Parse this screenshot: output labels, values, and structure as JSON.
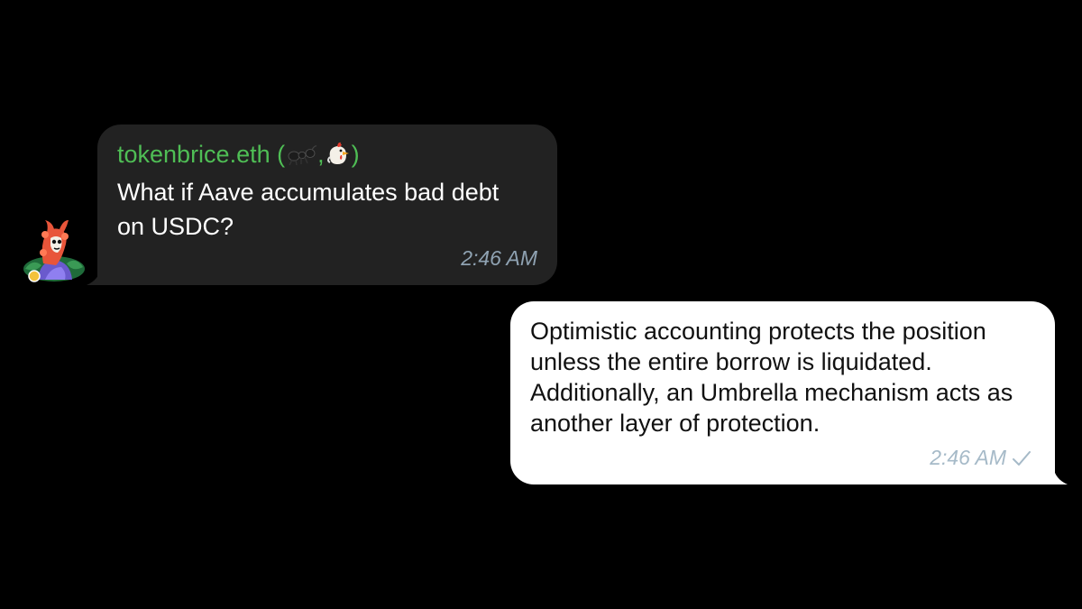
{
  "messages": {
    "incoming": {
      "sender": "tokenbrice.eth (",
      "sender_suffix": ")",
      "sender_emojis": [
        "ant-emoji",
        "chicken-emoji"
      ],
      "sender_separator": ",",
      "text": "What if Aave accumulates bad debt on USDC?",
      "time": "2:46 AM",
      "avatar": "llama-avatar"
    },
    "outgoing": {
      "text": "Optimistic accounting protects the position unless the entire borrow is liquidated. Additionally, an Umbrella mechanism acts as another layer of protection.",
      "time": "2:46 AM",
      "status": "sent-check-icon"
    }
  },
  "colors": {
    "background": "#000000",
    "incoming_bubble": "#222222",
    "outgoing_bubble": "#ffffff",
    "sender_name": "#4fbe55",
    "incoming_time": "#8fa2b2",
    "outgoing_time": "#a6bac8"
  }
}
